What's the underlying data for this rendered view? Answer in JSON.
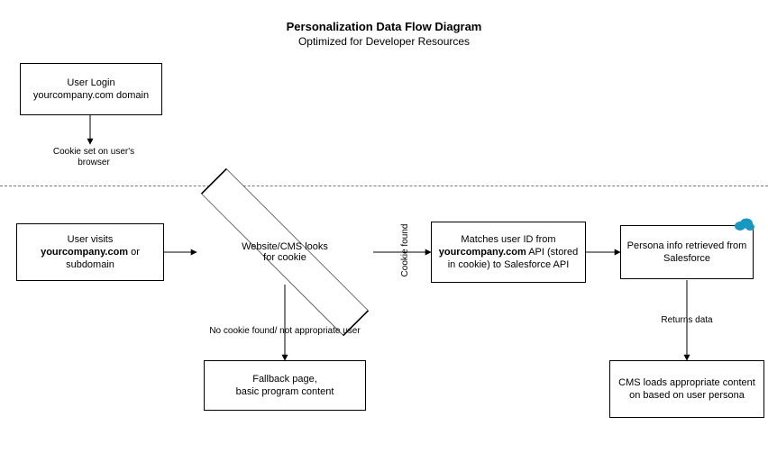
{
  "title": {
    "main": "Personalization Data Flow Diagram",
    "sub": "Optimized for Developer Resources"
  },
  "nodes": {
    "login": {
      "line1": "User Login",
      "line2": "yourcompany.com domain"
    },
    "visit": {
      "line1": "User visits",
      "bold": "yourcompany.com",
      "line2tail": " or subdomain"
    },
    "decision": "Website/CMS looks for cookie",
    "match": {
      "pre": "Matches user ID from ",
      "bold": "yourcompany.com",
      "post": " API (stored in cookie) to Salesforce API"
    },
    "persona": "Persona info retrieved from Salesforce",
    "fallback": "Fallback page,\nbasic program content",
    "cmsload": "CMS loads appropriate content on based on user persona"
  },
  "edges": {
    "cookieSet": "Cookie set on user's browser",
    "cookieFound": "Cookie found",
    "noCookie": "No cookie found/ not appropriate user",
    "returnsData": "Returns data"
  },
  "icons": {
    "salesforce": "salesforce-logo"
  }
}
